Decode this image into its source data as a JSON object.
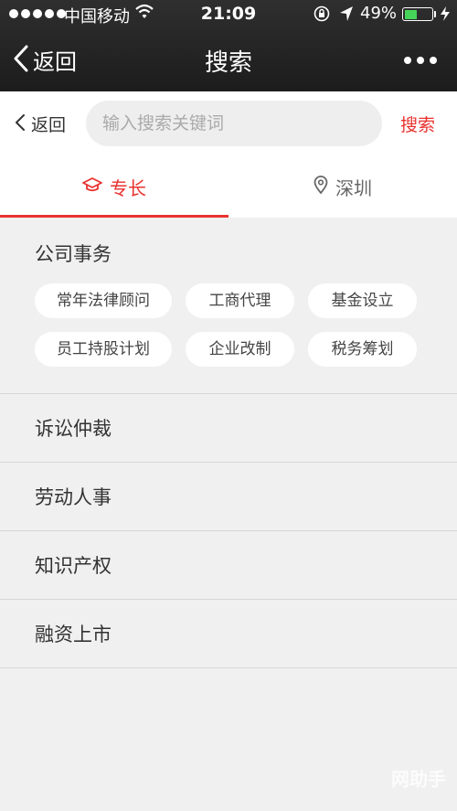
{
  "status_bar": {
    "carrier": "中国移动",
    "time": "21:09",
    "battery_percent": "49%",
    "battery_level": 0.49,
    "icons": [
      "signal-dots-icon",
      "wifi-icon",
      "rotation-lock-icon",
      "location-arrow-icon",
      "battery-icon",
      "charging-bolt-icon"
    ]
  },
  "nav": {
    "back_label": "返回",
    "title": "搜索",
    "more_icon": "more-dots-icon"
  },
  "search": {
    "back_label": "返回",
    "placeholder": "输入搜索关键词",
    "value": "",
    "button_label": "搜索"
  },
  "tabs": [
    {
      "label": "专长",
      "icon": "graduation-cap-icon",
      "active": true
    },
    {
      "label": "深圳",
      "icon": "location-pin-icon",
      "active": false
    }
  ],
  "section": {
    "title": "公司事务",
    "chips": [
      "常年法律顾问",
      "工商代理",
      "基金设立",
      "员工持股计划",
      "企业改制",
      "税务筹划"
    ]
  },
  "categories": [
    "诉讼仲裁",
    "劳动人事",
    "知识产权",
    "融资上市"
  ],
  "watermark": "网助手",
  "colors": {
    "accent": "#e8322e",
    "nav_bg": "#262626",
    "page_bg": "#f0f0f0",
    "battery_green": "#46d35a"
  }
}
